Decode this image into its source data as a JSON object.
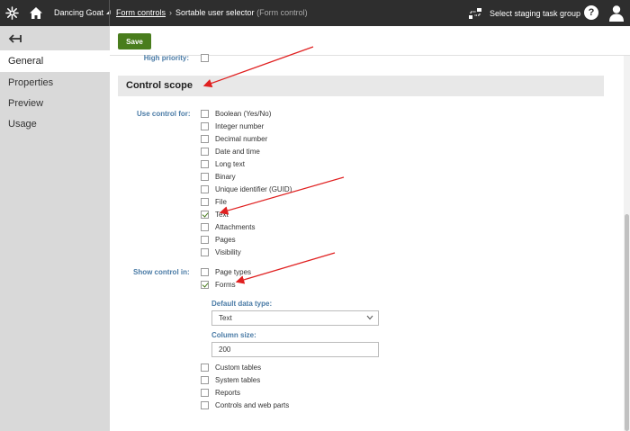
{
  "topbar": {
    "site_name": "Dancing Goat",
    "breadcrumb_link": "Form controls",
    "breadcrumb_current": "Sortable user selector",
    "breadcrumb_sub": "(Form control)",
    "staging_label": "Select staging task group",
    "help_label": "?"
  },
  "sidebar": {
    "items": [
      {
        "label": "General"
      },
      {
        "label": "Properties"
      },
      {
        "label": "Preview"
      },
      {
        "label": "Usage"
      }
    ]
  },
  "toolbar": {
    "save_label": "Save"
  },
  "form": {
    "high_priority_label": "High priority:",
    "section_title": "Control scope",
    "use_control_for_label": "Use control for:",
    "use_control_for": [
      {
        "label": "Boolean (Yes/No)",
        "checked": false
      },
      {
        "label": "Integer number",
        "checked": false
      },
      {
        "label": "Decimal number",
        "checked": false
      },
      {
        "label": "Date and time",
        "checked": false
      },
      {
        "label": "Long text",
        "checked": false
      },
      {
        "label": "Binary",
        "checked": false
      },
      {
        "label": "Unique identifier (GUID)",
        "checked": false
      },
      {
        "label": "File",
        "checked": false
      },
      {
        "label": "Text",
        "checked": true
      },
      {
        "label": "Attachments",
        "checked": false
      },
      {
        "label": "Pages",
        "checked": false
      },
      {
        "label": "Visibility",
        "checked": false
      }
    ],
    "show_control_in_label": "Show control in:",
    "show_control_in": [
      {
        "label": "Page types",
        "checked": false
      },
      {
        "label": "Forms",
        "checked": true
      }
    ],
    "default_data_type_label": "Default data type:",
    "default_data_type_value": "Text",
    "column_size_label": "Column size:",
    "column_size_value": "200",
    "show_control_in_more": [
      {
        "label": "Custom tables",
        "checked": false
      },
      {
        "label": "System tables",
        "checked": false
      },
      {
        "label": "Reports",
        "checked": false
      },
      {
        "label": "Controls and web parts",
        "checked": false
      }
    ]
  },
  "colors": {
    "topbar": "#2e2e2e",
    "save_button": "#497d1d",
    "label_blue": "#4a7ba6",
    "annotation_arrow": "#e02020"
  }
}
